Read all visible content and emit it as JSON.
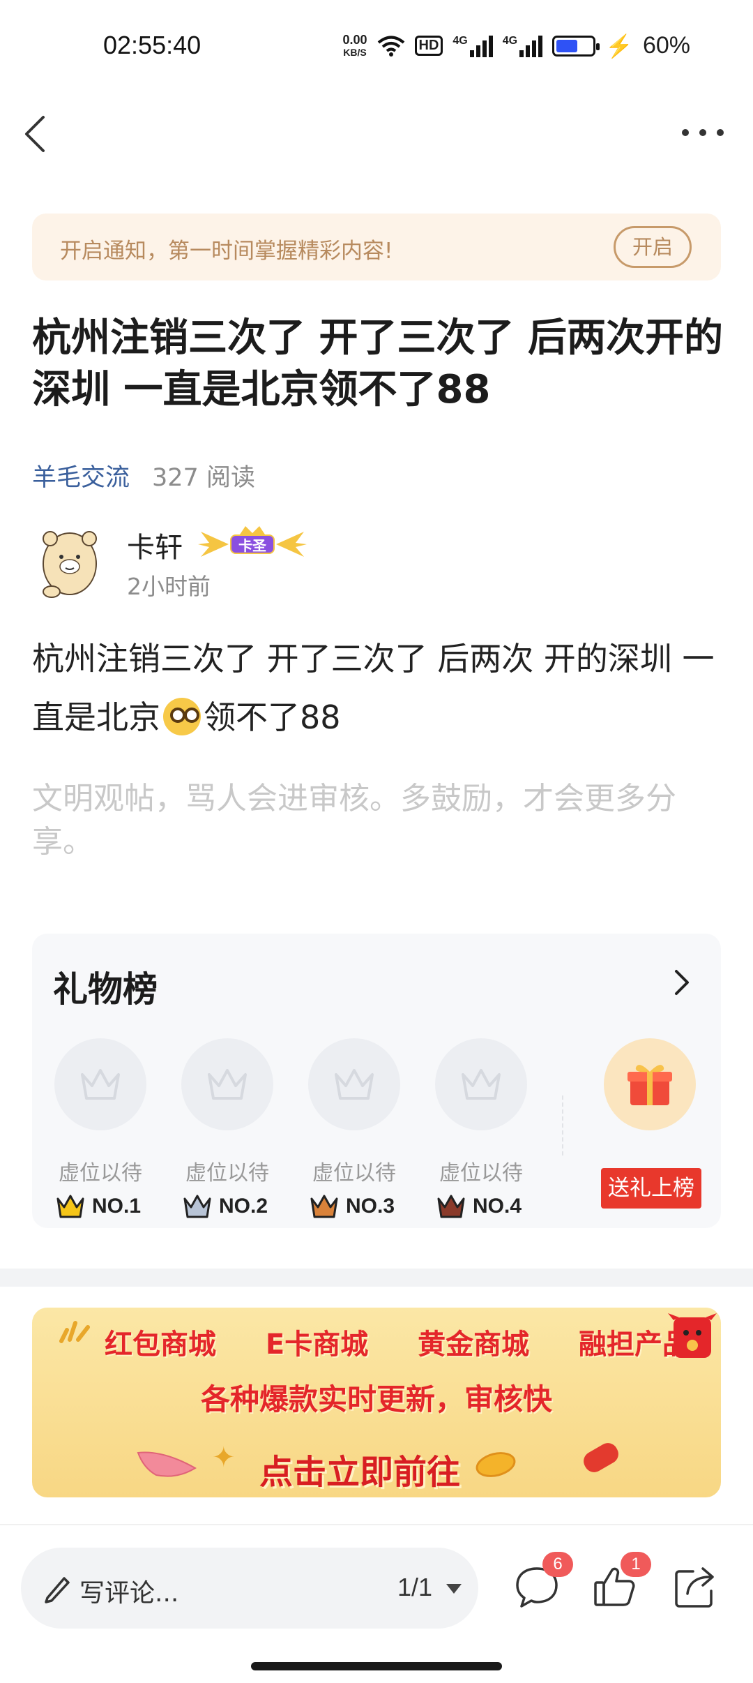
{
  "status_bar": {
    "time": "02:55:40",
    "net_speed_value": "0.00",
    "net_speed_unit": "KB/S",
    "hd_label": "HD",
    "network_type_1": "4G",
    "network_type_2": "4G",
    "battery_percent": "60%",
    "battery_level": 0.6
  },
  "nav": {
    "back_icon": "chevron-left-icon",
    "more_icon": "more-dots-icon"
  },
  "notification": {
    "text": "开启通知，第一时间掌握精彩内容!",
    "button_label": "开启"
  },
  "post": {
    "title": "杭州注销三次了 开了三次了 后两次开的深圳 一直是北京领不了88",
    "channel": "羊毛交流",
    "read_count": "327 阅读",
    "author": {
      "name": "卡轩",
      "badge_label": "卡圣",
      "time": "2小时前"
    },
    "body_before_emoji": "杭州注销三次了 开了三次了 后两次 开的深圳 一直是北京",
    "body_after_emoji": "领不了88",
    "hint": "文明观帖，骂人会进审核。多鼓励，才会更多分享。"
  },
  "gift_board": {
    "title": "礼物榜",
    "slots": [
      {
        "label": "虚位以待",
        "rank": "NO.1",
        "crown_color": "#f5c518"
      },
      {
        "label": "虚位以待",
        "rank": "NO.2",
        "crown_color": "#b8c4d6"
      },
      {
        "label": "虚位以待",
        "rank": "NO.3",
        "crown_color": "#d9823a"
      },
      {
        "label": "虚位以待",
        "rank": "NO.4",
        "crown_color": "#8a3a2a"
      }
    ],
    "send_gift_label": "送礼上榜"
  },
  "promo_banner": {
    "items": [
      "红包商城",
      "E卡商城",
      "黄金商城",
      "融担产品"
    ],
    "subtitle": "各种爆款实时更新，审核快",
    "cta": "点击立即前往"
  },
  "bottom_bar": {
    "comment_placeholder": "写评论...",
    "page_indicator": "1/1",
    "comment_count": "6",
    "like_count": "1"
  },
  "colors": {
    "accent_red": "#e8382c",
    "channel_blue": "#3a5f9c",
    "notify_bg": "#fdf3e8"
  }
}
